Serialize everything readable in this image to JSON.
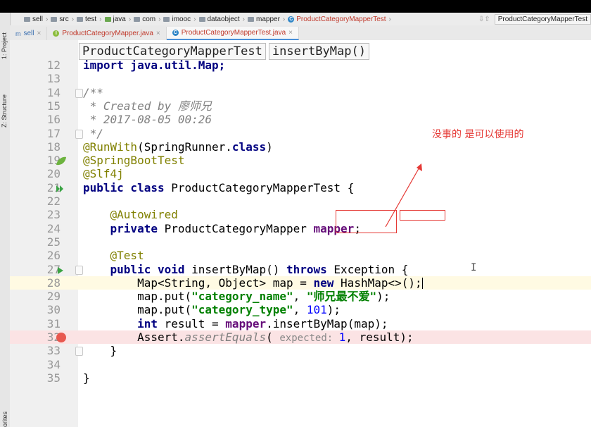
{
  "breadcrumb": {
    "items": [
      "sell",
      "src",
      "test",
      "java",
      "com",
      "imooc",
      "dataobject",
      "mapper",
      "ProductCategoryMapperTest"
    ],
    "run_config": "ProductCategoryMapperTest"
  },
  "sidebar": {
    "project_label": "1: Project",
    "structure_label": "Z: Structure",
    "favorites_label": "Favorites"
  },
  "tabs": [
    {
      "label": "sell"
    },
    {
      "label": "ProductCategoryMapper.java"
    },
    {
      "label": "ProductCategoryMapperTest.java"
    }
  ],
  "nav": {
    "class_name": "ProductCategoryMapperTest",
    "method_name": "insertByMap()"
  },
  "code": {
    "lines": [
      {
        "n": "12",
        "parts": [
          {
            "t": "import java.util.Map;",
            "c": "kw"
          }
        ]
      },
      {
        "n": "13",
        "parts": []
      },
      {
        "n": "14",
        "parts": [
          {
            "t": "/**",
            "c": "cmt"
          }
        ]
      },
      {
        "n": "15",
        "parts": [
          {
            "t": " * Created by 廖师兄",
            "c": "cmt"
          }
        ]
      },
      {
        "n": "16",
        "parts": [
          {
            "t": " * 2017-08-05 00:26",
            "c": "cmt"
          }
        ]
      },
      {
        "n": "17",
        "parts": [
          {
            "t": " */",
            "c": "cmt"
          }
        ]
      },
      {
        "n": "18",
        "parts": [
          {
            "t": "@RunWith",
            "c": "ann"
          },
          {
            "t": "(SpringRunner.",
            "c": ""
          },
          {
            "t": "class",
            "c": "kw"
          },
          {
            "t": ")",
            "c": ""
          }
        ]
      },
      {
        "n": "19",
        "parts": [
          {
            "t": "@SpringBootTest",
            "c": "ann"
          }
        ]
      },
      {
        "n": "20",
        "parts": [
          {
            "t": "@Slf4j",
            "c": "ann"
          }
        ]
      },
      {
        "n": "21",
        "parts": [
          {
            "t": "public class ",
            "c": "kw"
          },
          {
            "t": "ProductCategoryMapperTest {",
            "c": ""
          }
        ]
      },
      {
        "n": "22",
        "parts": []
      },
      {
        "n": "23",
        "parts": [
          {
            "t": "    @Autowired",
            "c": "ann"
          }
        ]
      },
      {
        "n": "24",
        "parts": [
          {
            "t": "    private ",
            "c": "kw"
          },
          {
            "t": "ProductCategoryMapper ",
            "c": ""
          },
          {
            "t": "mapper",
            "c": "fld"
          },
          {
            "t": ";",
            "c": ""
          }
        ]
      },
      {
        "n": "25",
        "parts": []
      },
      {
        "n": "26",
        "parts": [
          {
            "t": "    @Test",
            "c": "ann"
          }
        ]
      },
      {
        "n": "27",
        "parts": [
          {
            "t": "    public void ",
            "c": "kw"
          },
          {
            "t": "insertByMap() ",
            "c": ""
          },
          {
            "t": "throws ",
            "c": "kw"
          },
          {
            "t": "Exception {",
            "c": ""
          }
        ]
      },
      {
        "n": "28",
        "parts": [
          {
            "t": "        Map<String, Object> map = ",
            "c": ""
          },
          {
            "t": "new ",
            "c": "kw"
          },
          {
            "t": "HashMap<>();",
            "c": ""
          }
        ]
      },
      {
        "n": "29",
        "parts": [
          {
            "t": "        map.put(",
            "c": ""
          },
          {
            "t": "\"category_name\"",
            "c": "str"
          },
          {
            "t": ", ",
            "c": ""
          },
          {
            "t": "\"师兄最不爱\"",
            "c": "str"
          },
          {
            "t": ");",
            "c": ""
          }
        ]
      },
      {
        "n": "30",
        "parts": [
          {
            "t": "        map.put(",
            "c": ""
          },
          {
            "t": "\"category_type\"",
            "c": "str"
          },
          {
            "t": ", ",
            "c": ""
          },
          {
            "t": "101",
            "c": "num"
          },
          {
            "t": ");",
            "c": ""
          }
        ]
      },
      {
        "n": "31",
        "parts": [
          {
            "t": "        ",
            "c": ""
          },
          {
            "t": "int ",
            "c": "kw"
          },
          {
            "t": "result = ",
            "c": ""
          },
          {
            "t": "mapper",
            "c": "fld"
          },
          {
            "t": ".insertByMap(map);",
            "c": ""
          }
        ]
      },
      {
        "n": "32",
        "parts": [
          {
            "t": "        Assert.",
            "c": ""
          },
          {
            "t": "assertEquals",
            "c": "cmt"
          },
          {
            "t": "( ",
            "c": ""
          },
          {
            "t": "expected: ",
            "c": "hint"
          },
          {
            "t": "1",
            "c": "num"
          },
          {
            "t": ", result);",
            "c": ""
          }
        ]
      },
      {
        "n": "33",
        "parts": [
          {
            "t": "    }",
            "c": ""
          }
        ]
      },
      {
        "n": "34",
        "parts": []
      },
      {
        "n": "35",
        "parts": [
          {
            "t": "}",
            "c": ""
          }
        ]
      }
    ]
  },
  "annotation": {
    "text": "没事的 是可以使用的",
    "color": "#e53935"
  },
  "colors": {
    "keyword": "#000080",
    "annotation": "#808000",
    "string": "#008000",
    "comment": "#808080"
  }
}
